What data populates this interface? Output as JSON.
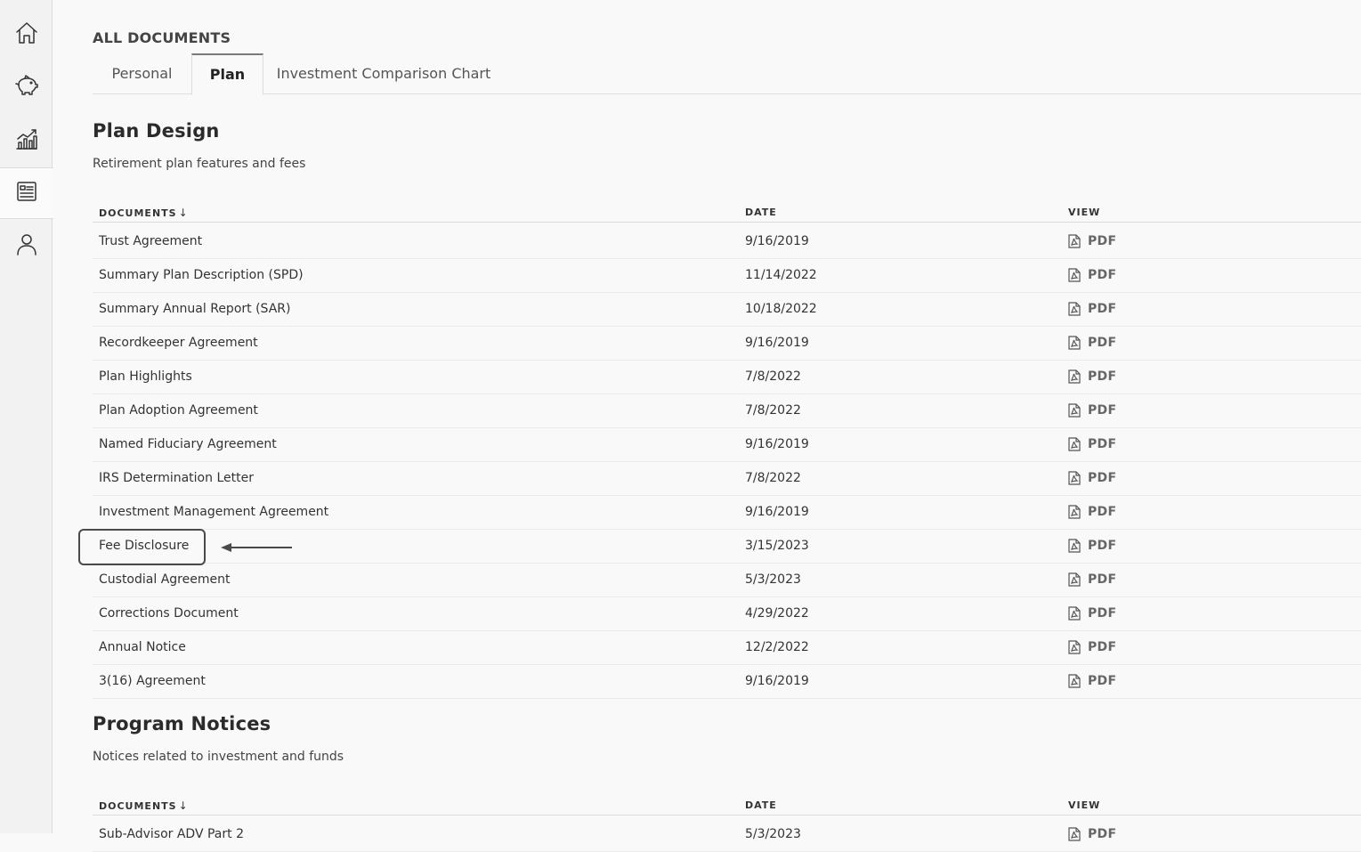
{
  "sidebar": {
    "items": [
      {
        "name": "home",
        "icon": "home-icon",
        "active": false
      },
      {
        "name": "savings",
        "icon": "piggy-bank-icon",
        "active": false
      },
      {
        "name": "performance",
        "icon": "growth-chart-icon",
        "active": false
      },
      {
        "name": "documents",
        "icon": "document-icon",
        "active": true
      },
      {
        "name": "profile",
        "icon": "user-icon",
        "active": false
      }
    ]
  },
  "header": {
    "title": "ALL DOCUMENTS"
  },
  "tabs": [
    {
      "label": "Personal",
      "active": false
    },
    {
      "label": "Plan",
      "active": true
    },
    {
      "label": "Investment Comparison Chart",
      "active": false
    }
  ],
  "sections": [
    {
      "title": "Plan Design",
      "subtitle": "Retirement plan features and fees",
      "columns": {
        "documents": "DOCUMENTS",
        "sort_arrow": "↓",
        "date": "DATE",
        "view": "VIEW"
      },
      "rows": [
        {
          "name": "Trust Agreement",
          "date": "9/16/2019",
          "view": "PDF"
        },
        {
          "name": "Summary Plan Description (SPD)",
          "date": "11/14/2022",
          "view": "PDF"
        },
        {
          "name": "Summary Annual Report (SAR)",
          "date": "10/18/2022",
          "view": "PDF"
        },
        {
          "name": "Recordkeeper Agreement",
          "date": "9/16/2019",
          "view": "PDF"
        },
        {
          "name": "Plan Highlights",
          "date": "7/8/2022",
          "view": "PDF"
        },
        {
          "name": "Plan Adoption Agreement",
          "date": "7/8/2022",
          "view": "PDF"
        },
        {
          "name": "Named Fiduciary Agreement",
          "date": "9/16/2019",
          "view": "PDF"
        },
        {
          "name": "IRS Determination Letter",
          "date": "7/8/2022",
          "view": "PDF"
        },
        {
          "name": "Investment Management Agreement",
          "date": "9/16/2019",
          "view": "PDF"
        },
        {
          "name": "Fee Disclosure",
          "date": "3/15/2023",
          "view": "PDF"
        },
        {
          "name": "Custodial Agreement",
          "date": "5/3/2023",
          "view": "PDF"
        },
        {
          "name": "Corrections Document",
          "date": "4/29/2022",
          "view": "PDF"
        },
        {
          "name": "Annual Notice",
          "date": "12/2/2022",
          "view": "PDF"
        },
        {
          "name": "3(16) Agreement",
          "date": "9/16/2019",
          "view": "PDF"
        }
      ]
    },
    {
      "title": "Program Notices",
      "subtitle": "Notices related to investment and funds",
      "columns": {
        "documents": "DOCUMENTS",
        "sort_arrow": "↓",
        "date": "DATE",
        "view": "VIEW"
      },
      "rows": [
        {
          "name": "Sub-Advisor ADV Part 2",
          "date": "5/3/2023",
          "view": "PDF"
        }
      ]
    }
  ],
  "annotation": {
    "highlighted_row": "Fee Disclosure",
    "color": "#4a4a4a"
  }
}
